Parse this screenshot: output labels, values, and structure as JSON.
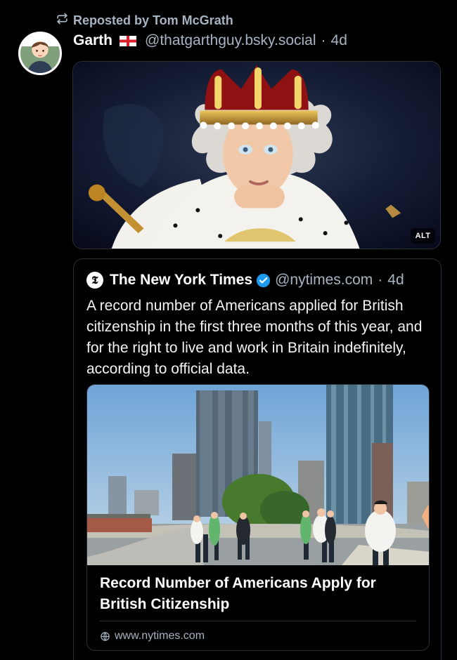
{
  "repost": {
    "label": "Reposted by Tom McGrath",
    "icon": "repost-icon"
  },
  "post": {
    "author_name": "Garth",
    "flag": "england-flag-icon",
    "handle": "@thatgarthguy.bsky.social",
    "separator": "·",
    "time": "4d",
    "image_alt_badge": "ALT"
  },
  "quote": {
    "logo_glyph": "𝕿",
    "author_name": "The New York Times",
    "verified_icon": "verified-badge-icon",
    "handle": "@nytimes.com",
    "separator": "·",
    "time": "4d",
    "text": "A record number of Americans applied for British citizenship in the first three months of this year, and for the right to live and work in Britain indefinitely, according to official data.",
    "link": {
      "title": "Record Number of Americans Apply for British Citizenship",
      "domain": "www.nytimes.com"
    }
  },
  "colors": {
    "background": "#000000",
    "muted": "#a7b3c1",
    "border": "#2b3038",
    "verified": "#1d9bf0"
  }
}
